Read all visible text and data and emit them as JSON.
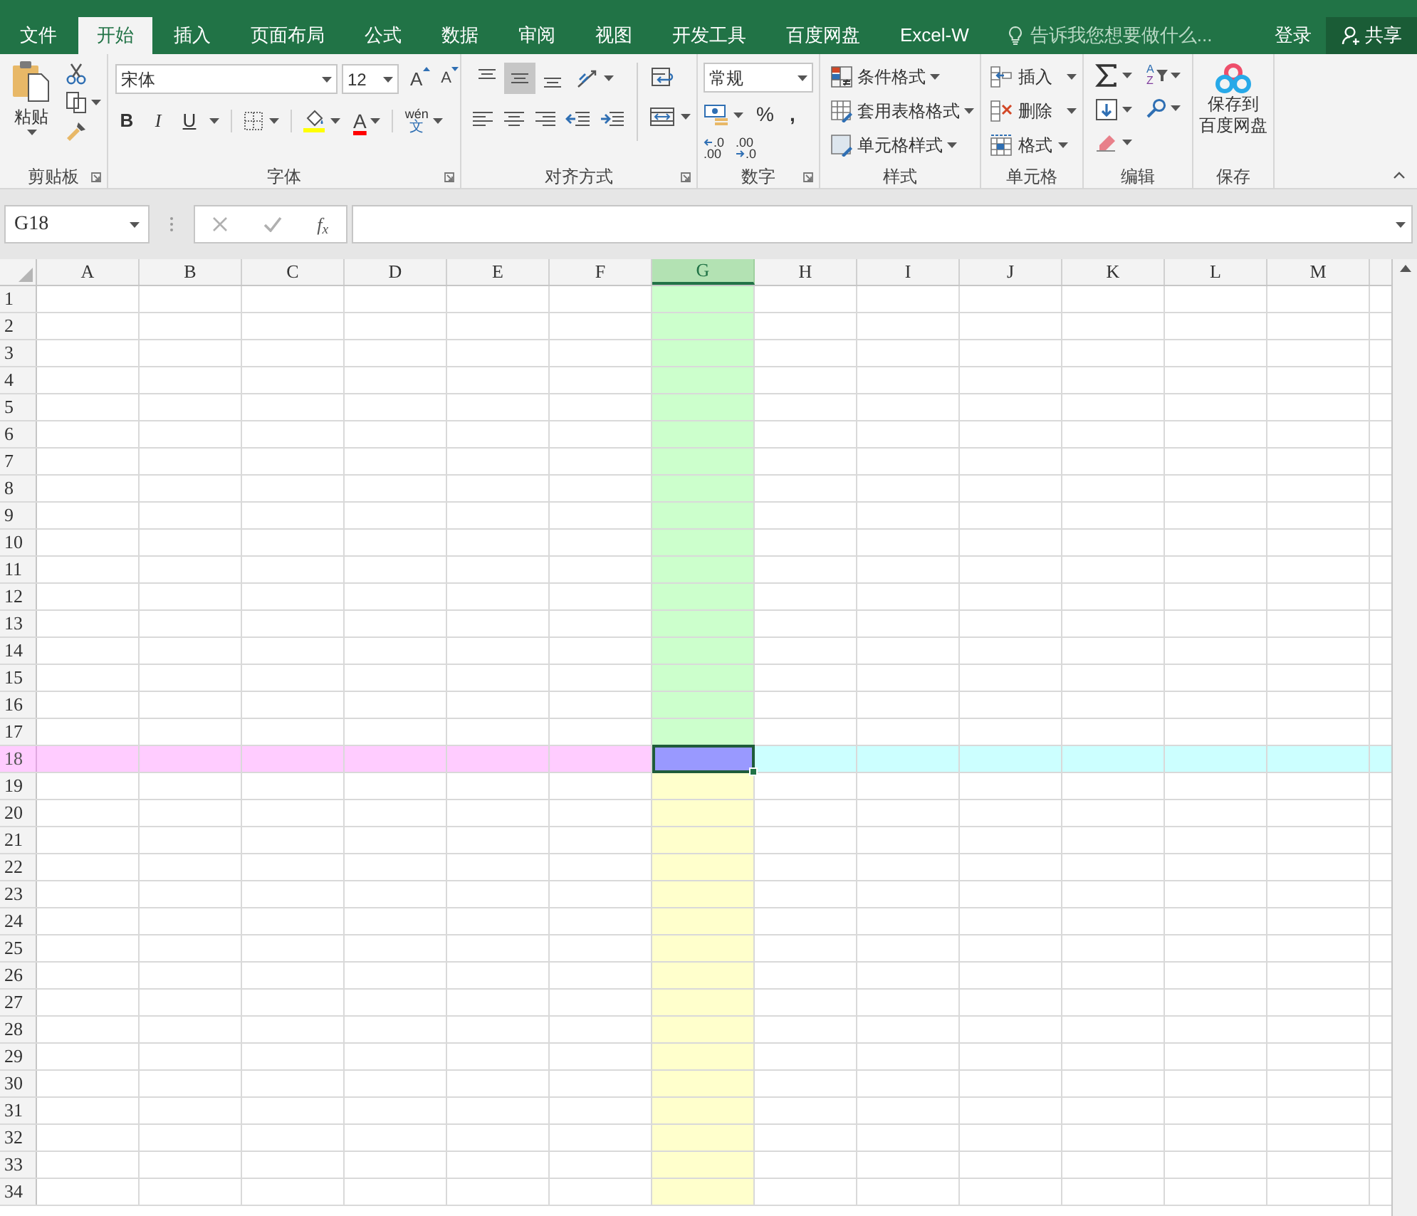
{
  "tabs": [
    {
      "label": "文件",
      "selected": false
    },
    {
      "label": "开始",
      "selected": true
    },
    {
      "label": "插入",
      "selected": false
    },
    {
      "label": "页面布局",
      "selected": false
    },
    {
      "label": "公式",
      "selected": false
    },
    {
      "label": "数据",
      "selected": false
    },
    {
      "label": "审阅",
      "selected": false
    },
    {
      "label": "视图",
      "selected": false
    },
    {
      "label": "开发工具",
      "selected": false
    },
    {
      "label": "百度网盘",
      "selected": false
    },
    {
      "label": "Excel-W",
      "selected": false
    }
  ],
  "tell_me": {
    "placeholder": "告诉我您想要做什么..."
  },
  "sign_in": "登录",
  "share": "共享",
  "clipboard": {
    "label": "剪贴板",
    "paste": "粘贴"
  },
  "font": {
    "label": "字体",
    "name": "宋体",
    "size": "12",
    "grow": "A",
    "shrink": "A",
    "styles": [
      {
        "kind": "bold",
        "label": "B"
      },
      {
        "kind": "italic",
        "label": "I"
      },
      {
        "kind": "underline",
        "label": "U"
      }
    ],
    "font_color_letter": "A",
    "phonetic": {
      "top": "wén",
      "bottom": "文"
    }
  },
  "alignment": {
    "label": "对齐方式",
    "vertical": [
      {
        "kind": "top",
        "selected": false
      },
      {
        "kind": "middle",
        "selected": true
      },
      {
        "kind": "bottom",
        "selected": false
      }
    ]
  },
  "number": {
    "label": "数字",
    "format": "常规",
    "percent": "%",
    "comma": ",",
    "decimals": [
      {
        "kind": "increase",
        "top": ".0",
        "bottom": ".00"
      },
      {
        "kind": "decrease",
        "top": ".00",
        "bottom": ".0"
      }
    ]
  },
  "styles": {
    "label": "样式",
    "items": [
      "条件格式",
      "套用表格格式",
      "单元格样式"
    ]
  },
  "cells": {
    "label": "单元格",
    "items": [
      "插入",
      "删除",
      "格式"
    ]
  },
  "editing": {
    "label": "编辑",
    "sort_letters": [
      "A",
      "Z"
    ]
  },
  "save": {
    "label": "保存",
    "button_lines": [
      "保存到",
      "百度网盘"
    ]
  },
  "formula_bar": {
    "name_box": "G18",
    "fx": "f$_{x}$"
  },
  "grid": {
    "columns": [
      {
        "label": "A",
        "selected": false
      },
      {
        "label": "B",
        "selected": false
      },
      {
        "label": "C",
        "selected": false
      },
      {
        "label": "D",
        "selected": false
      },
      {
        "label": "E",
        "selected": false
      },
      {
        "label": "F",
        "selected": false
      },
      {
        "label": "G",
        "selected": true
      },
      {
        "label": "H",
        "selected": false
      },
      {
        "label": "I",
        "selected": false
      },
      {
        "label": "J",
        "selected": false
      },
      {
        "label": "K",
        "selected": false
      },
      {
        "label": "L",
        "selected": false
      },
      {
        "label": "M",
        "selected": false
      }
    ],
    "rows": [
      {
        "label": "1",
        "selected": false
      },
      {
        "label": "2",
        "selected": false
      },
      {
        "label": "3",
        "selected": false
      },
      {
        "label": "4",
        "selected": false
      },
      {
        "label": "5",
        "selected": false
      },
      {
        "label": "6",
        "selected": false
      },
      {
        "label": "7",
        "selected": false
      },
      {
        "label": "8",
        "selected": false
      },
      {
        "label": "9",
        "selected": false
      },
      {
        "label": "10",
        "selected": false
      },
      {
        "label": "11",
        "selected": false
      },
      {
        "label": "12",
        "selected": false
      },
      {
        "label": "13",
        "selected": false
      },
      {
        "label": "14",
        "selected": false
      },
      {
        "label": "15",
        "selected": false
      },
      {
        "label": "16",
        "selected": false
      },
      {
        "label": "17",
        "selected": false
      },
      {
        "label": "18",
        "selected": true
      },
      {
        "label": "19",
        "selected": false
      },
      {
        "label": "20",
        "selected": false
      },
      {
        "label": "21",
        "selected": false
      },
      {
        "label": "22",
        "selected": false
      },
      {
        "label": "23",
        "selected": false
      },
      {
        "label": "24",
        "selected": false
      },
      {
        "label": "25",
        "selected": false
      },
      {
        "label": "26",
        "selected": false
      },
      {
        "label": "27",
        "selected": false
      },
      {
        "label": "28",
        "selected": false
      },
      {
        "label": "29",
        "selected": false
      },
      {
        "label": "30",
        "selected": false
      },
      {
        "label": "31",
        "selected": false
      },
      {
        "label": "32",
        "selected": false
      },
      {
        "label": "33",
        "selected": false
      },
      {
        "label": "34",
        "selected": false
      }
    ]
  }
}
